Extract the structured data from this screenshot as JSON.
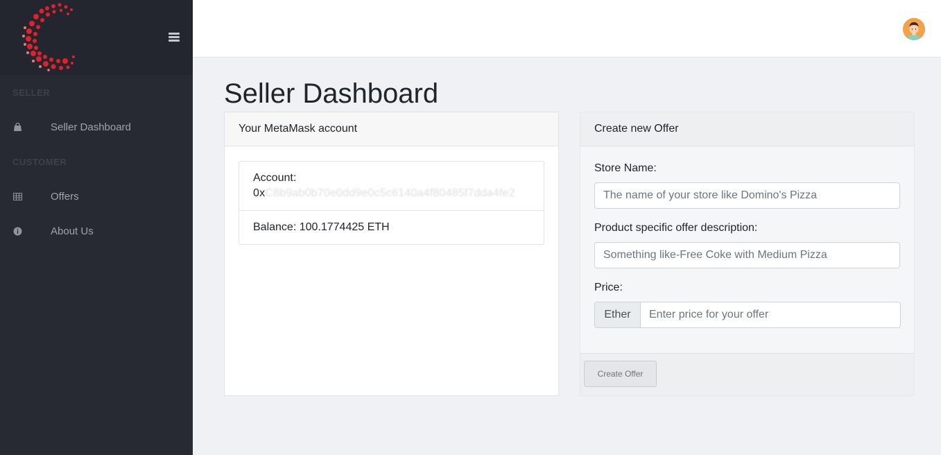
{
  "sidebar": {
    "sections": [
      {
        "title": "SELLER"
      },
      {
        "title": "CUSTOMER"
      }
    ],
    "items": [
      {
        "label": "Seller Dashboard",
        "icon": "bag-icon"
      },
      {
        "label": "Offers",
        "icon": "table-icon"
      },
      {
        "label": "About Us",
        "icon": "info-icon"
      }
    ]
  },
  "page": {
    "title": "Seller Dashboard"
  },
  "account_card": {
    "header": "Your MetaMask account",
    "account_label": "Account:",
    "address_prefix": "0x",
    "address_redacted": "C8b9ab0b70e0dd9e0c5c6140a4f80485f7dda4fe2",
    "balance": "Balance: 100.1774425 ETH"
  },
  "offer_card": {
    "header": "Create new Offer",
    "store_label": "Store Name:",
    "store_placeholder": "The name of your store like Domino's Pizza",
    "desc_label": "Product specific offer description:",
    "desc_placeholder": "Something like-Free Coke with Medium Pizza",
    "price_label": "Price:",
    "price_prepend": "Ether",
    "price_placeholder": "Enter price for your offer",
    "button": "Create Offer"
  },
  "colors": {
    "sidebar_bg": "#272a33",
    "logo_red": "#e0212b",
    "avatar_bg": "#f4a24a"
  }
}
